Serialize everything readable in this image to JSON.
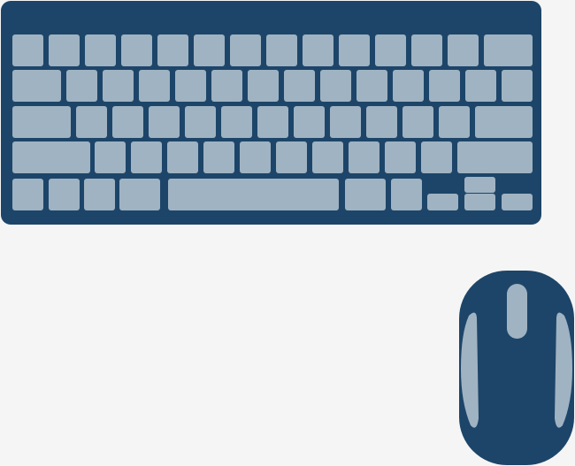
{
  "colors": {
    "background": "#f5f5f5",
    "device_body": "#1d4569",
    "key_face": "#a0b3c2"
  },
  "keyboard": {
    "icon": "keyboard-icon"
  },
  "mouse": {
    "icon": "mouse-icon"
  }
}
